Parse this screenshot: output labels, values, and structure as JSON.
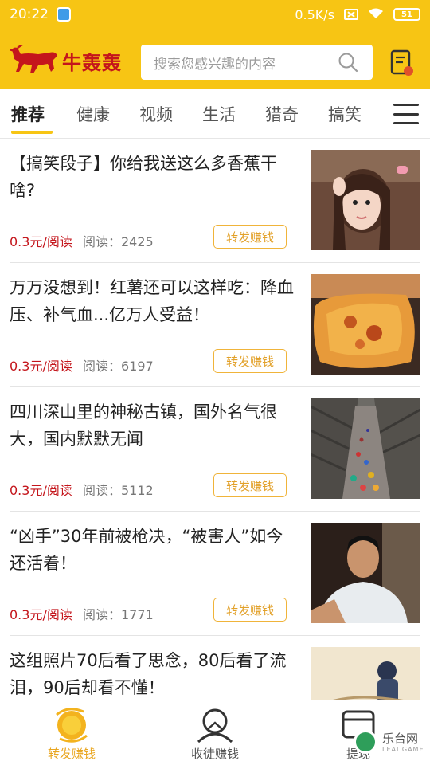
{
  "status_bar": {
    "time": "20:22",
    "speed": "0.5K/s",
    "battery": "51"
  },
  "header": {
    "logo_text": "牛轰轰",
    "search_placeholder": "搜索您感兴趣的内容"
  },
  "tabs": [
    {
      "label": "推荐",
      "active": true
    },
    {
      "label": "健康",
      "active": false
    },
    {
      "label": "视频",
      "active": false
    },
    {
      "label": "生活",
      "active": false
    },
    {
      "label": "猎奇",
      "active": false
    },
    {
      "label": "搞笑",
      "active": false
    }
  ],
  "feed": [
    {
      "title": "【搞笑段子】你给我送这么多香蕉干啥?",
      "price": "0.3元/阅读",
      "reads": "阅读：2425",
      "share_label": "转发赚钱",
      "thumb": "portrait-girl"
    },
    {
      "title": "万万没想到！红薯还可以这样吃：降血压、补气血...亿万人受益！",
      "price": "0.3元/阅读",
      "reads": "阅读：6197",
      "share_label": "转发赚钱",
      "thumb": "roasted-sweet-potato"
    },
    {
      "title": "四川深山里的神秘古镇，国外名气很大，国内默默无闻",
      "price": "0.3元/阅读",
      "reads": "阅读：5112",
      "share_label": "转发赚钱",
      "thumb": "ancient-town-street"
    },
    {
      "title": "“凶手”30年前被枪决，“被害人”如今还活着！",
      "price": "0.3元/阅读",
      "reads": "阅读：1771",
      "share_label": "转发赚钱",
      "thumb": "man-portrait"
    },
    {
      "title": "这组照片70后看了思念，80后看了流泪，90后却看不懂！",
      "price": "",
      "reads": "",
      "share_label": "",
      "thumb": "cartoon-illustration"
    }
  ],
  "bottom_nav": [
    {
      "label": "转发赚钱",
      "active": true,
      "icon": "coin-icon"
    },
    {
      "label": "收徒赚钱",
      "active": false,
      "icon": "apprentice-icon"
    },
    {
      "label": "提现",
      "active": false,
      "icon": "wallet-icon"
    }
  ],
  "watermark": {
    "text": "乐台网",
    "sub": "LEAI GAME"
  },
  "colors": {
    "brand_yellow": "#f7c514",
    "price_red": "#c4161c",
    "share_orange": "#e2a12a"
  }
}
